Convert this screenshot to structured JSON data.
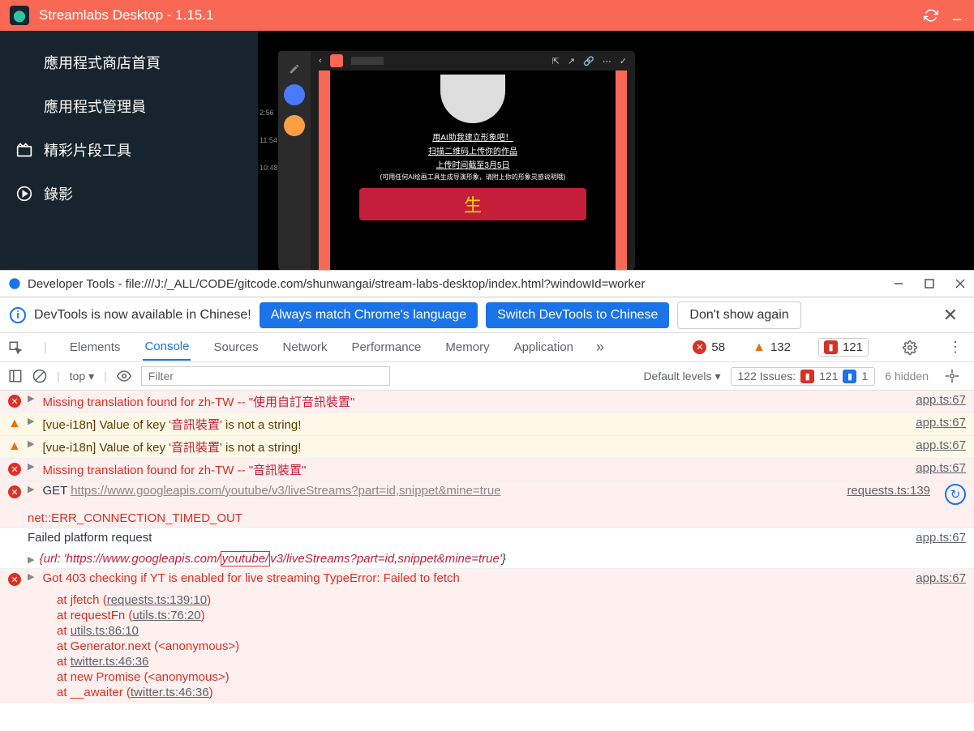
{
  "titlebar": {
    "title": "Streamlabs Desktop - 1.15.1"
  },
  "sidebar": {
    "items": [
      {
        "label": "應用程式商店首頁"
      },
      {
        "label": "應用程式管理員"
      },
      {
        "label": "精彩片段工具"
      },
      {
        "label": "錄影"
      }
    ]
  },
  "chat": {
    "headline": "用AI助我建立形象吧！",
    "line2": "扫描二维码上传你的作品",
    "line3": "上传时间截至3月5日",
    "line4": "(可用任何AI绘画工具生成导演形象，请附上你的形象灵感说明哦)",
    "times": [
      "2:56",
      "11:54",
      "10:48"
    ],
    "card_text": "生"
  },
  "devtools": {
    "window_title": "Developer Tools - file:///J:/_ALL/CODE/gitcode.com/shunwangai/stream-labs-desktop/index.html?windowId=worker",
    "banner": {
      "text": "DevTools is now available in Chinese!",
      "btn1": "Always match Chrome's language",
      "btn2": "Switch DevTools to Chinese",
      "btn3": "Don't show again"
    },
    "tabs": [
      "Elements",
      "Console",
      "Sources",
      "Network",
      "Performance",
      "Memory",
      "Application"
    ],
    "counts": {
      "errors": "58",
      "warnings": "132",
      "issues": "121"
    },
    "toolbar": {
      "context": "top",
      "filter_placeholder": "Filter",
      "levels": "Default levels",
      "issues_label": "122 Issues:",
      "issues_red": "121",
      "issues_blue": "1",
      "hidden": "6 hidden"
    },
    "logs": {
      "l1_msg": "Missing translation found for zh-TW -- ",
      "l1_str": "\"使用自訂音訊裝置\"",
      "l1_src": "app.ts:67",
      "l2_pre": "[vue-i18n] Value of key ",
      "l2_key": "'音訊裝置'",
      "l2_post": " is not a string!",
      "l2_src": "app.ts:67",
      "l3_src": "app.ts:67",
      "l4_msg": "Missing translation found for zh-TW -- ",
      "l4_str": "\"音訊裝置\"",
      "l4_src": "app.ts:67",
      "l5_method": "GET",
      "l5_url": "https://www.googleapis.com/youtube/v3/liveStreams?part=id,snippet&mine=true",
      "l5_err": "net::ERR_CONNECTION_TIMED_OUT",
      "l5_src": "requests.ts:139",
      "l6_msg": "Failed platform request",
      "l6_src": "app.ts:67",
      "l6_obj_pre": "{url: ",
      "l6_obj_url1": "'https://www.googleapis.com/",
      "l6_obj_yt": "youtube/",
      "l6_obj_url2": "v3/liveStreams?part=id,snippet&mine=true'",
      "l6_obj_post": "}",
      "l7_msg": "Got 403 checking if YT is enabled for live streaming TypeError: Failed to fetch",
      "l7_src": "app.ts:67",
      "stack": {
        "s1a": "at jfetch (",
        "s1b": "requests.ts:139:10",
        "s1c": ")",
        "s2a": "at requestFn (",
        "s2b": "utils.ts:76:20",
        "s2c": ")",
        "s3a": "at ",
        "s3b": "utils.ts:86:10",
        "s4": "at Generator.next (<anonymous>)",
        "s5a": "at ",
        "s5b": "twitter.ts:46:36",
        "s6": "at new Promise (<anonymous>)",
        "s7a": "at __awaiter (",
        "s7b": "twitter.ts:46:36",
        "s7c": ")"
      }
    }
  }
}
